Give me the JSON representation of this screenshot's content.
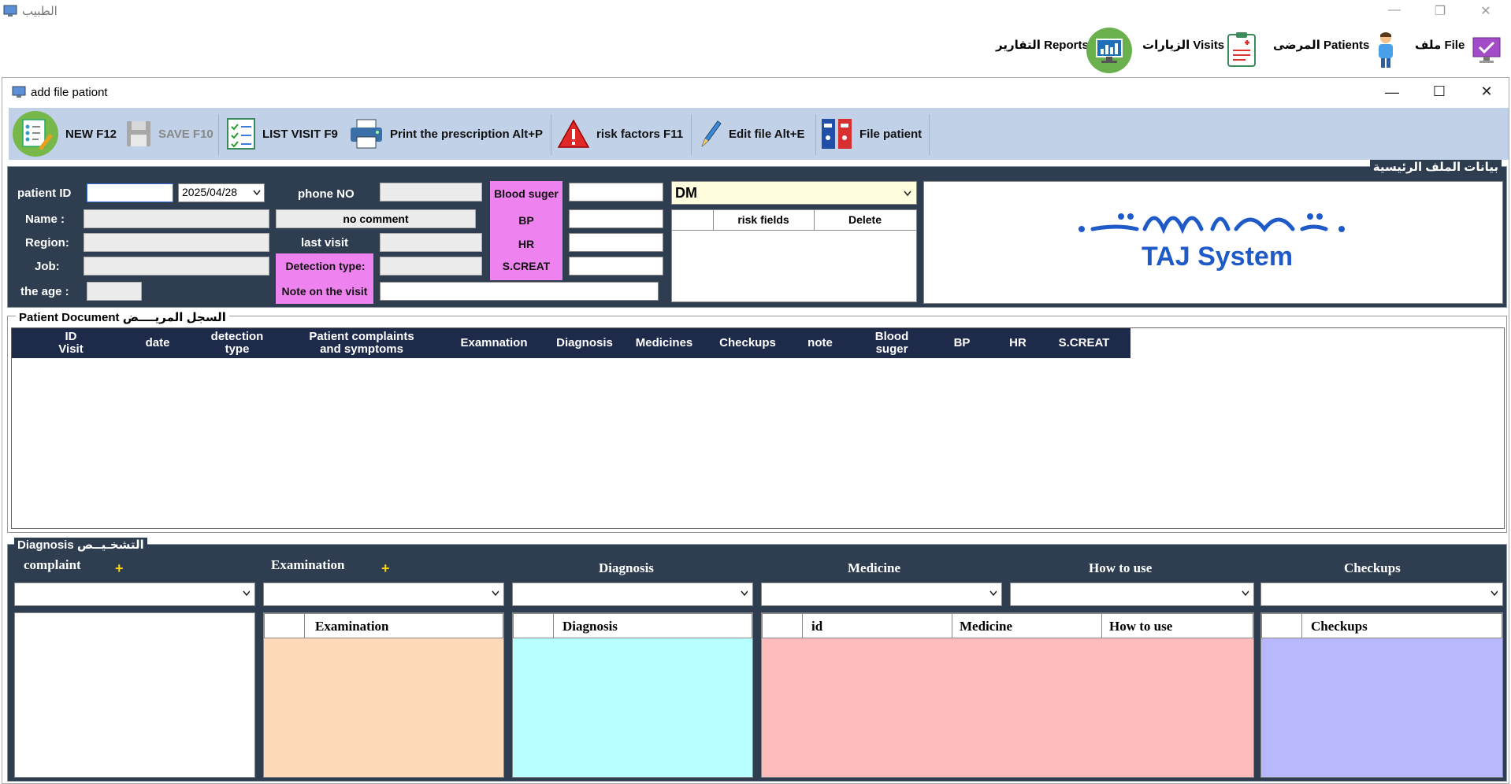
{
  "app": {
    "title": "الطبيب",
    "window_controls": {
      "minimize": "—",
      "maximize": "❐",
      "close": "✕"
    },
    "nav": [
      {
        "label": "ملف File",
        "icon": "monitor-check-icon"
      },
      {
        "label": "المرضى Patients",
        "icon": "patient-icon"
      },
      {
        "label": "الزيارات Visits",
        "icon": "clipboard-icon"
      },
      {
        "label": "التقارير Reports",
        "icon": "reports-icon"
      }
    ]
  },
  "dialog": {
    "title": "add file pationt",
    "window_controls": {
      "minimize": "—",
      "maximize": "☐",
      "close": "✕"
    }
  },
  "toolbar": {
    "new": "NEW F12",
    "save": "SAVE F10",
    "list_visit": "LIST VISIT  F9",
    "print": "Print the prescription Alt+P",
    "risk": "risk factors F11",
    "edit": "Edit file Alt+E",
    "file_patient": "File patient"
  },
  "main_data": {
    "legend": "بيانات الملف الرئيسية",
    "patient_id_label": "patient ID",
    "patient_id_value": "",
    "date_value": "2025/04/28",
    "name_label": "Name :",
    "region_label": "Region:",
    "job_label": "Job:",
    "age_label": "the age :",
    "comment_value": "no comment",
    "phone_label": "phone NO",
    "last_visit_label": "last visit",
    "detection_type_label": "Detection type:",
    "note_label": "Note on the visit",
    "blood_sugar_label": "Blood suger",
    "bp_label": "BP",
    "hr_label": "HR",
    "screat_label": "S.CREAT",
    "risk_combo_value": "DM",
    "risk_grid_headers": {
      "risk_fields": "risk fields",
      "delete": "Delete"
    },
    "logo_text": "TAJ System"
  },
  "patient_document": {
    "legend": "Patient Document السجل المريــــض",
    "columns": [
      {
        "line1": "ID",
        "line2": "Visit"
      },
      {
        "line1": "date",
        "line2": ""
      },
      {
        "line1": "detection",
        "line2": "type"
      },
      {
        "line1": "Patient complaints",
        "line2": "and symptoms"
      },
      {
        "line1": "Examnation",
        "line2": ""
      },
      {
        "line1": "Diagnosis",
        "line2": ""
      },
      {
        "line1": "Medicines",
        "line2": ""
      },
      {
        "line1": "Checkups",
        "line2": ""
      },
      {
        "line1": "note",
        "line2": ""
      },
      {
        "line1": "Blood",
        "line2": "suger"
      },
      {
        "line1": "BP",
        "line2": ""
      },
      {
        "line1": "HR",
        "line2": ""
      },
      {
        "line1": "S.CREAT",
        "line2": ""
      }
    ]
  },
  "diagnosis": {
    "legend": "Diagnosis التشخـيــص",
    "complaint_label": "complaint",
    "examination_label": "Examination",
    "diagnosis_label": "Diagnosis",
    "medicine_label": "Medicine",
    "how_to_use_label": "How to use",
    "checkups_label": "Checkups",
    "add_symbol": "+",
    "grids": {
      "examination_header": "Examination",
      "diagnosis_header": "Diagnosis",
      "medicine_id_header": "id",
      "medicine_header": "Medicine",
      "how_to_use_header": "How to use",
      "checkups_header": "Checkups"
    },
    "colors": {
      "examination": "#ffdab9",
      "diagnosis": "#b8ffff",
      "medicine": "#ffbcbc",
      "checkups": "#b8b8ff"
    }
  }
}
